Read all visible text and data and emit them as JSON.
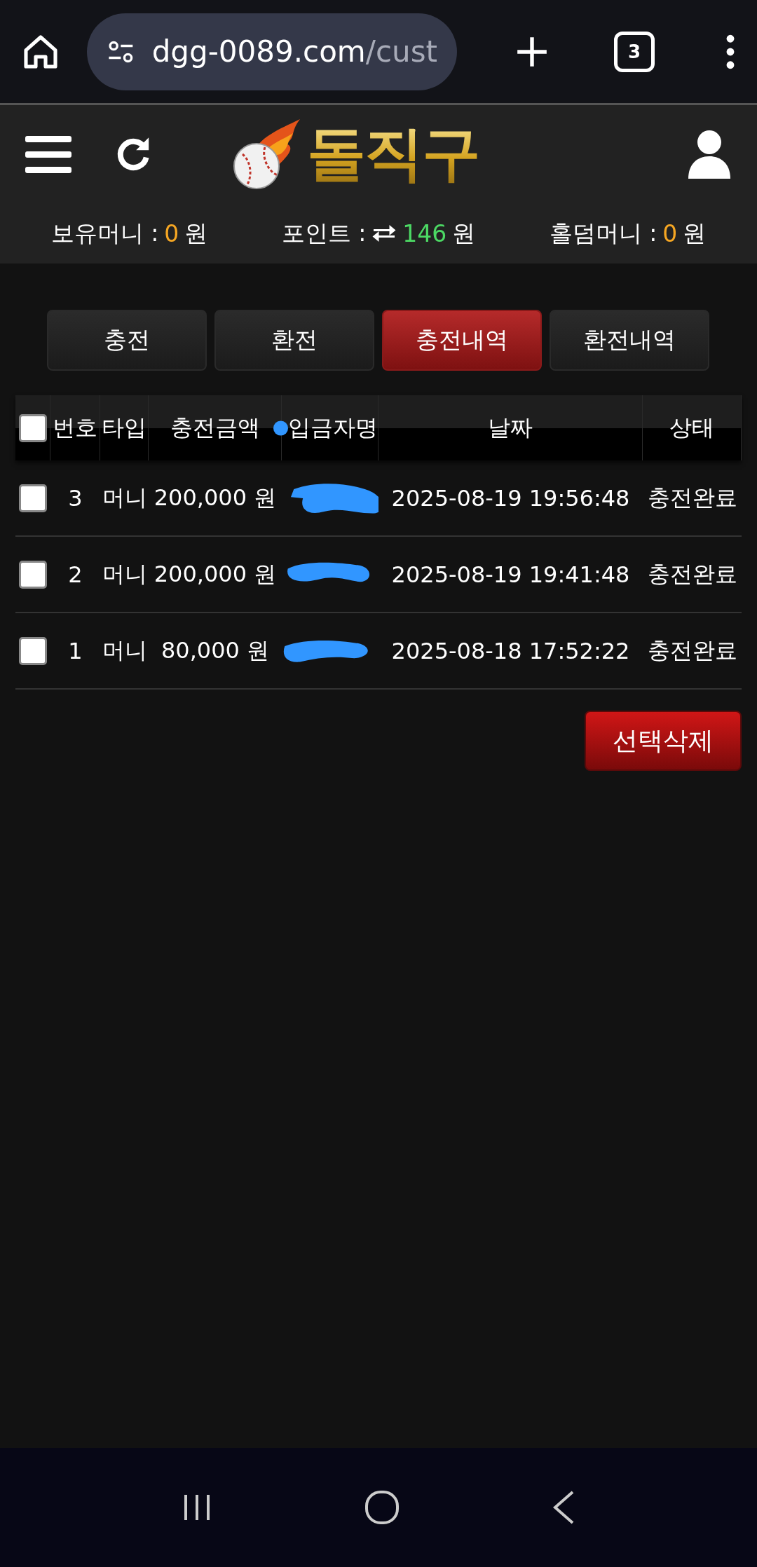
{
  "browser": {
    "url_host": "dgg-0089.com",
    "url_path": "/cust",
    "tab_count": "3"
  },
  "logo": {
    "text": "돌직구"
  },
  "balances": [
    {
      "label": "보유머니 :",
      "value": "0",
      "unit": "원",
      "color": "#f5a623",
      "kind": "plain"
    },
    {
      "label": "포인트 :",
      "value": "146",
      "unit": "원",
      "color": "#4cd964",
      "kind": "exchange"
    },
    {
      "label": "홀덤머니 :",
      "value": "0",
      "unit": "원",
      "color": "#f5a623",
      "kind": "plain"
    }
  ],
  "tabs": [
    {
      "label": "충전",
      "selected": false
    },
    {
      "label": "환전",
      "selected": false
    },
    {
      "label": "충전내역",
      "selected": true
    },
    {
      "label": "환전내역",
      "selected": false
    }
  ],
  "table": {
    "all_checked": false,
    "columns": [
      "번호",
      "타입",
      "충전금액",
      "입금자명",
      "날짜",
      "상태"
    ],
    "rows": [
      {
        "checked": false,
        "number": "3",
        "type": "머니",
        "amount": "200,000 원",
        "date": "2025-08-19 19:56:48",
        "status": "충전완료"
      },
      {
        "checked": false,
        "number": "2",
        "type": "머니",
        "amount": "200,000 원",
        "date": "2025-08-19 19:41:48",
        "status": "충전완료"
      },
      {
        "checked": false,
        "number": "1",
        "type": "머니",
        "amount": "80,000 원",
        "date": "2025-08-18 17:52:22",
        "status": "충전완료"
      }
    ]
  },
  "delete_button": "선택삭제"
}
